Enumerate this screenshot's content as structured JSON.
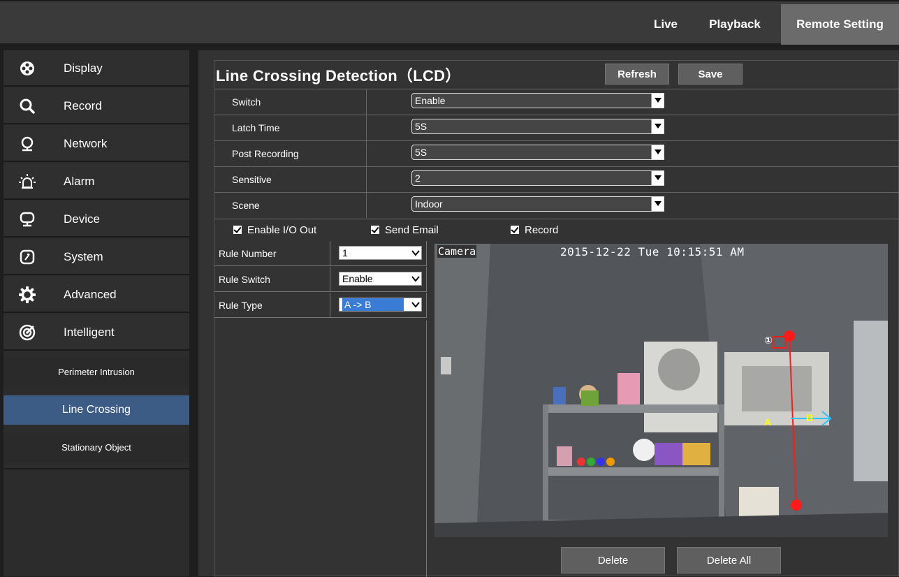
{
  "topnav": {
    "live": "Live",
    "playback": "Playback",
    "remote_setting": "Remote Setting"
  },
  "sidebar": {
    "items": [
      {
        "label": "Display",
        "icon": "display-icon"
      },
      {
        "label": "Record",
        "icon": "search-icon"
      },
      {
        "label": "Network",
        "icon": "network-icon"
      },
      {
        "label": "Alarm",
        "icon": "alarm-icon"
      },
      {
        "label": "Device",
        "icon": "device-icon"
      },
      {
        "label": "System",
        "icon": "system-icon"
      },
      {
        "label": "Advanced",
        "icon": "gear-icon"
      },
      {
        "label": "Intelligent",
        "icon": "intelligent-icon"
      }
    ],
    "subitems": [
      {
        "label": "Perimeter Intrusion"
      },
      {
        "label": "Line Crossing",
        "active": true
      },
      {
        "label": "Stationary Object"
      }
    ]
  },
  "panel": {
    "title": "Line Crossing Detection（LCD）",
    "refresh_label": "Refresh",
    "save_label": "Save",
    "settings": [
      {
        "label": "Switch",
        "value": "Enable"
      },
      {
        "label": "Latch Time",
        "value": "5S"
      },
      {
        "label": "Post Recording",
        "value": "5S"
      },
      {
        "label": "Sensitive",
        "value": "2"
      },
      {
        "label": "Scene",
        "value": "Indoor"
      }
    ],
    "checks": [
      {
        "label": "Enable I/O Out",
        "checked": true
      },
      {
        "label": "Send Email",
        "checked": true
      },
      {
        "label": "Record",
        "checked": true
      }
    ],
    "rules": [
      {
        "label": "Rule Number",
        "value": "1"
      },
      {
        "label": "Rule Switch",
        "value": "Enable"
      },
      {
        "label": "Rule Type",
        "value": "A -> B"
      }
    ],
    "camera": {
      "label": "Camera",
      "timestamp": "2015-12-22 Tue 10:15:51 AM",
      "rule_marker": "①",
      "side_a": "A",
      "side_b": "B"
    },
    "delete_label": "Delete",
    "delete_all_label": "Delete All"
  },
  "colors": {
    "active_nav": "#6b6b6b",
    "active_subitem": "#3c5c86",
    "detection_line": "#ff1a1a",
    "direction_arrow": "#29c4ff"
  }
}
